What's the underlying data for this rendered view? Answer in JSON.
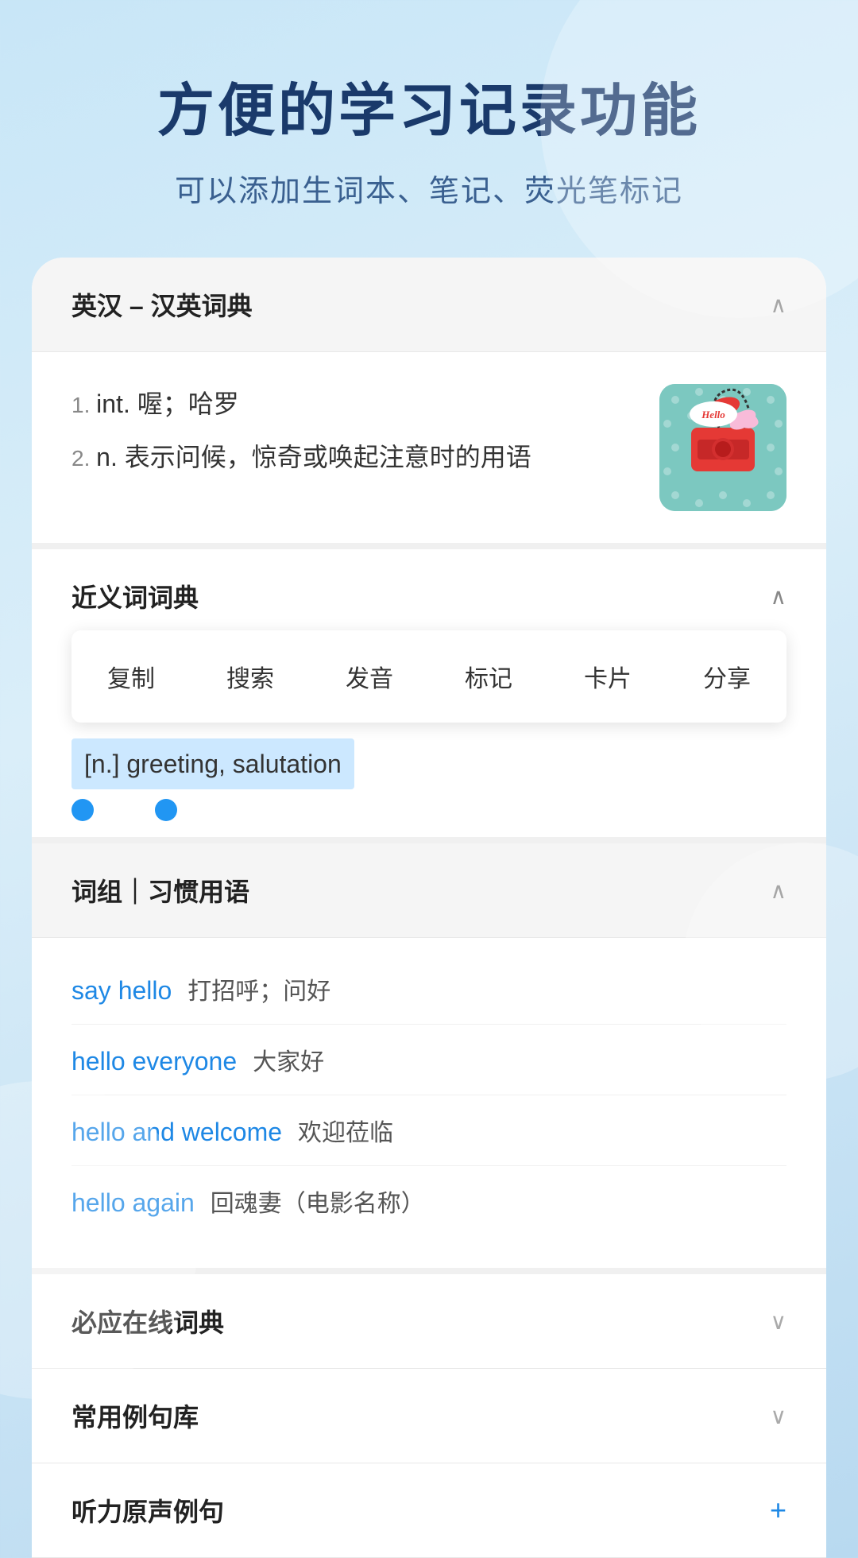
{
  "header": {
    "title": "方便的学习记录功能",
    "subtitle": "可以添加生词本、笔记、荧光笔标记"
  },
  "section_english_chinese": {
    "label": "英汉 – 汉英词典",
    "entries": [
      {
        "index": "1.",
        "type": "int.",
        "definition": "喔；哈罗"
      },
      {
        "index": "2.",
        "type": "n.",
        "definition": "表示问候，惊奇或唤起注意时的用语"
      }
    ]
  },
  "section_synonyms": {
    "label": "近义词词典",
    "context_menu": [
      "复制",
      "搜索",
      "发音",
      "标记",
      "卡片",
      "分享"
    ],
    "selected_text": "[n.] greeting, salutation"
  },
  "section_phrases": {
    "label": "词组｜习惯用语",
    "items": [
      {
        "english": "say hello",
        "chinese": "打招呼；问好"
      },
      {
        "english": "hello everyone",
        "chinese": "大家好"
      },
      {
        "english": "hello and welcome",
        "chinese": "欢迎莅临"
      },
      {
        "english": "hello again",
        "chinese": "回魂妻（电影名称）"
      }
    ]
  },
  "section_biyingzaixian": {
    "label": "必应在线词典"
  },
  "section_changyong": {
    "label": "常用例句库"
  },
  "section_tingli": {
    "label": "听力原声例句"
  },
  "icons": {
    "chevron_up": "∧",
    "chevron_down": "∨",
    "plus": "+"
  }
}
